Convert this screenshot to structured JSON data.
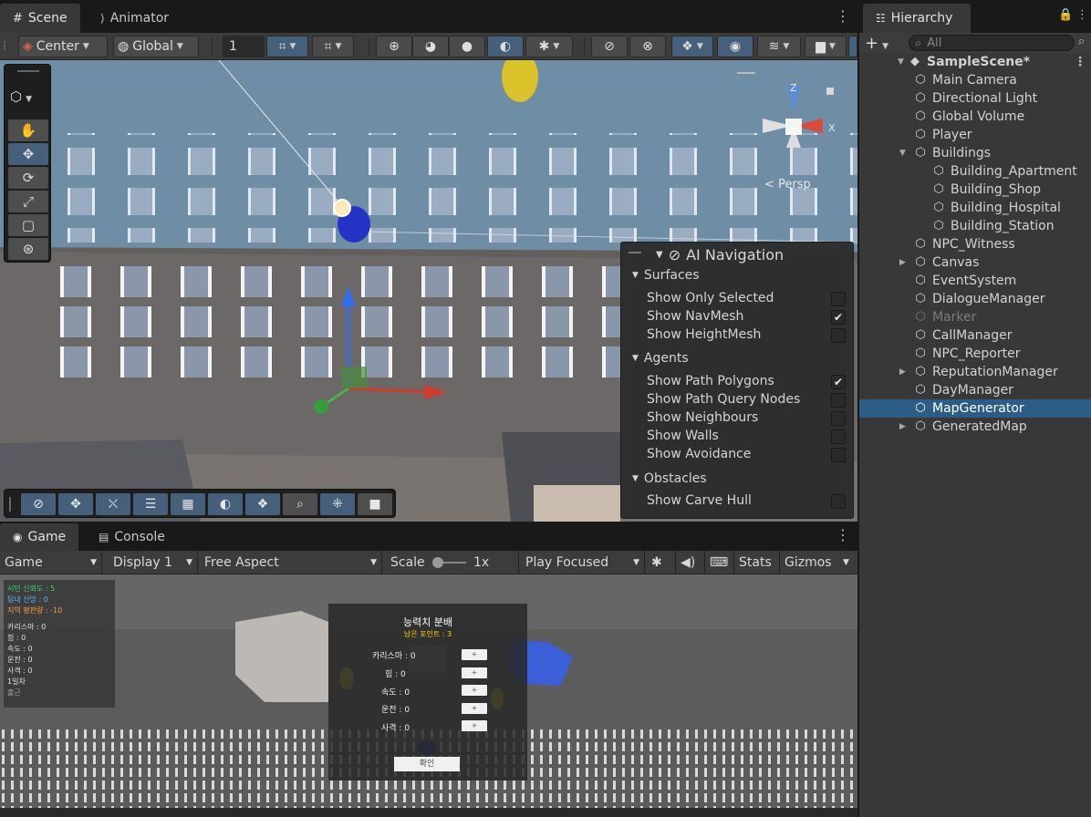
{
  "scene": {
    "tabs": [
      {
        "label": "Scene",
        "icon": "grid-icon"
      },
      {
        "label": "Animator",
        "icon": "animator-icon"
      }
    ],
    "toolbar": {
      "pivot_label": "Center",
      "space_label": "Global",
      "grid_size": "1"
    },
    "gizmo_label": "< Persp",
    "axis_labels": {
      "y": "Z",
      "x": "X"
    }
  },
  "ai_navigation": {
    "title": "AI Navigation",
    "sections": [
      {
        "label": "Surfaces",
        "items": [
          {
            "label": "Show Only Selected",
            "checked": false
          },
          {
            "label": "Show NavMesh",
            "checked": true
          },
          {
            "label": "Show HeightMesh",
            "checked": false
          }
        ]
      },
      {
        "label": "Agents",
        "items": [
          {
            "label": "Show Path Polygons",
            "checked": true
          },
          {
            "label": "Show Path Query Nodes",
            "checked": false
          },
          {
            "label": "Show Neighbours",
            "checked": false
          },
          {
            "label": "Show Walls",
            "checked": false
          },
          {
            "label": "Show Avoidance",
            "checked": false
          }
        ]
      },
      {
        "label": "Obstacles",
        "items": [
          {
            "label": "Show Carve Hull",
            "checked": false
          }
        ]
      }
    ]
  },
  "hierarchy": {
    "title": "Hierarchy",
    "search_placeholder": "All",
    "scene_name": "SampleScene*",
    "items": [
      {
        "label": "Main Camera",
        "depth": 1,
        "expand": "",
        "state": ""
      },
      {
        "label": "Directional Light",
        "depth": 1,
        "expand": "",
        "state": ""
      },
      {
        "label": "Global Volume",
        "depth": 1,
        "expand": "",
        "state": ""
      },
      {
        "label": "Player",
        "depth": 1,
        "expand": "",
        "state": ""
      },
      {
        "label": "Buildings",
        "depth": 1,
        "expand": "open",
        "state": ""
      },
      {
        "label": "Building_Apartment",
        "depth": 2,
        "expand": "",
        "state": ""
      },
      {
        "label": "Building_Shop",
        "depth": 2,
        "expand": "",
        "state": ""
      },
      {
        "label": "Building_Hospital",
        "depth": 2,
        "expand": "",
        "state": ""
      },
      {
        "label": "Building_Station",
        "depth": 2,
        "expand": "",
        "state": ""
      },
      {
        "label": "NPC_Witness",
        "depth": 1,
        "expand": "",
        "state": ""
      },
      {
        "label": "Canvas",
        "depth": 1,
        "expand": "closed",
        "state": ""
      },
      {
        "label": "EventSystem",
        "depth": 1,
        "expand": "",
        "state": ""
      },
      {
        "label": "DialogueManager",
        "depth": 1,
        "expand": "",
        "state": ""
      },
      {
        "label": "Marker",
        "depth": 1,
        "expand": "",
        "state": "disabled"
      },
      {
        "label": "CallManager",
        "depth": 1,
        "expand": "",
        "state": ""
      },
      {
        "label": "NPC_Reporter",
        "depth": 1,
        "expand": "",
        "state": ""
      },
      {
        "label": "ReputationManager",
        "depth": 1,
        "expand": "closed",
        "state": ""
      },
      {
        "label": "DayManager",
        "depth": 1,
        "expand": "",
        "state": ""
      },
      {
        "label": "MapGenerator",
        "depth": 1,
        "expand": "",
        "state": "selected"
      },
      {
        "label": "GeneratedMap",
        "depth": 1,
        "expand": "closed",
        "state": ""
      }
    ]
  },
  "game": {
    "tabs": [
      {
        "label": "Game",
        "icon": "gamepad-icon"
      },
      {
        "label": "Console",
        "icon": "console-icon"
      }
    ],
    "toolbar": {
      "mode": "Game",
      "display": "Display 1",
      "aspect": "Free Aspect",
      "scale_label": "Scale",
      "scale_value": "1x",
      "play_mode": "Play Focused",
      "stats": "Stats",
      "gizmos": "Gizmos"
    },
    "hud": {
      "trust_citizen": "시민 신뢰도 : 5",
      "trust_internal": "팀내 신망 : 0",
      "regional": "지역 평판량 : -10",
      "charisma": "카리스마 : 0",
      "strength": "힘 : 0",
      "speed": "속도 : 0",
      "driving": "운전 : 0",
      "shooting": "사격 : 0",
      "day": "1일차",
      "work": "출근"
    },
    "dialog": {
      "title": "능력치 분배",
      "points": "남은 포인트 : 3",
      "stats": [
        {
          "label": "카리스마 : 0",
          "button": "+"
        },
        {
          "label": "힘 : 0",
          "button": "+"
        },
        {
          "label": "속도 : 0",
          "button": "+"
        },
        {
          "label": "운전 : 0",
          "button": "+"
        },
        {
          "label": "사격 : 0",
          "button": "+"
        }
      ],
      "confirm": "확인"
    }
  },
  "colors": {
    "accent": "#46607c",
    "selection": "#2c5d87",
    "sky": "#6f8ea5"
  }
}
